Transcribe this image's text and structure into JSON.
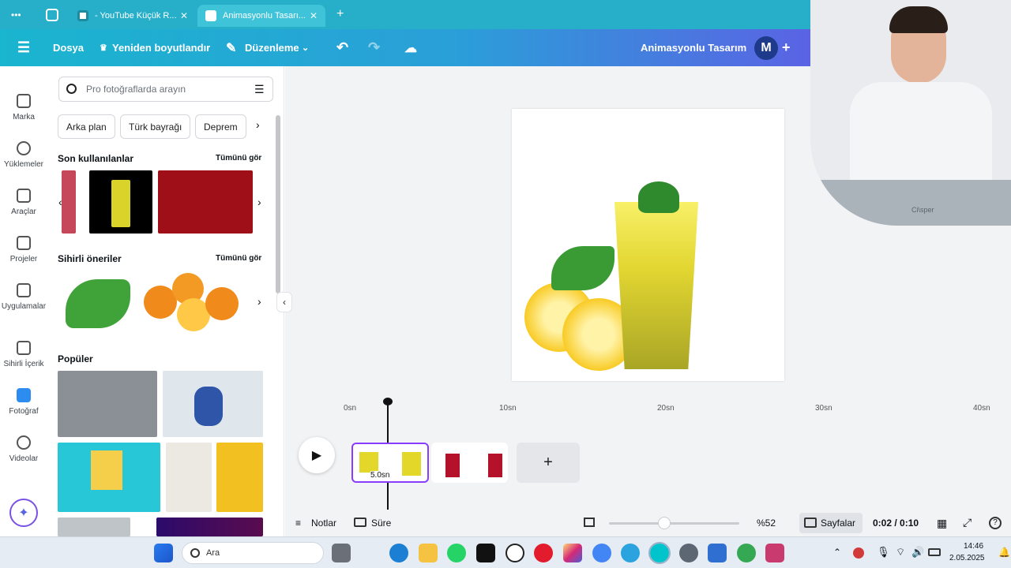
{
  "browser": {
    "tabs": [
      {
        "title": "- YouTube Küçük R..."
      },
      {
        "title": "Animasyonlu Tasarı..."
      }
    ],
    "new_tab": "+",
    "more": "•••"
  },
  "toolbar": {
    "menu": "☰",
    "file": "Dosya",
    "resize": "Yeniden boyutlandır",
    "edit": "Düzenleme",
    "title": "Animasyonlu Tasarım",
    "avatar": "M",
    "add": "+"
  },
  "rail": [
    {
      "label": "Marka"
    },
    {
      "label": "Yüklemeler"
    },
    {
      "label": "Araçlar"
    },
    {
      "label": "Projeler"
    },
    {
      "label": "Uygulamalar"
    },
    {
      "label": "Sihirli İçerik"
    },
    {
      "label": "Fotoğraf"
    },
    {
      "label": "Videolar"
    }
  ],
  "panel": {
    "search_placeholder": "Pro fotoğraflarda arayın",
    "chips": [
      "Arka plan",
      "Türk bayrağı",
      "Deprem"
    ],
    "recent_title": "Son kullanılanlar",
    "magic_title": "Sihirli öneriler",
    "popular_title": "Popüler",
    "see_all": "Tümünü gör"
  },
  "timeline": {
    "ticks": [
      "0sn",
      "10sn",
      "20sn",
      "30sn",
      "40sn"
    ],
    "clip_duration": "5.0sn",
    "add": "+"
  },
  "bottom": {
    "notes": "Notlar",
    "duration": "Süre",
    "zoom": "%52",
    "pages": "Sayfalar",
    "time": "0:02 / 0:10",
    "help": "?"
  },
  "taskbar": {
    "search": "Ara",
    "time": "14:46",
    "date": "2.05.2025"
  },
  "colors": {
    "accent": "#8b3dff",
    "toolbar_start": "#1ab5cf",
    "toolbar_end": "#7a52e6"
  }
}
